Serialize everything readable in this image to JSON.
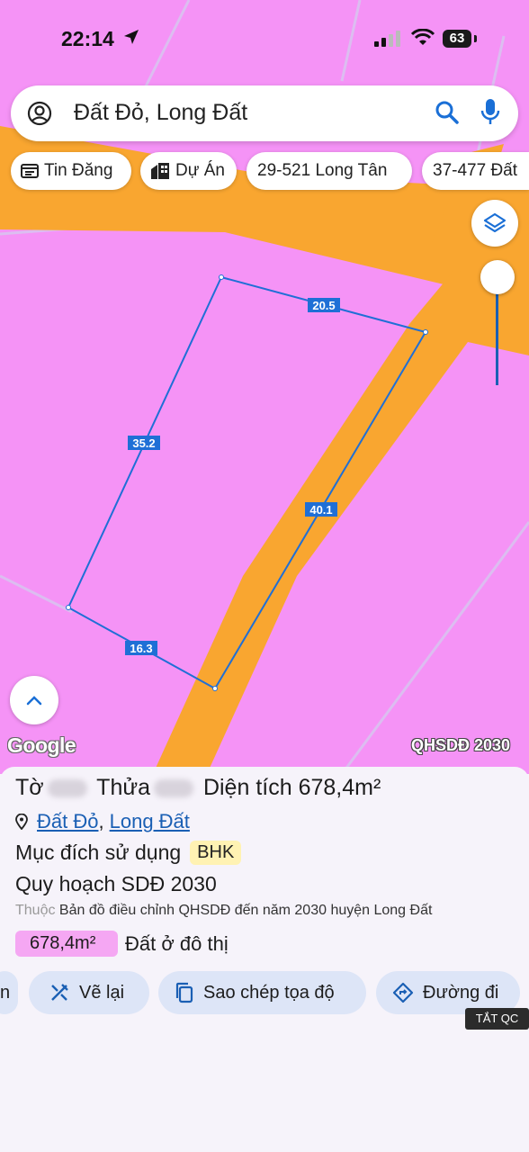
{
  "status": {
    "time": "22:14",
    "battery": "63"
  },
  "search": {
    "query": "Đất Đỏ, Long Đất"
  },
  "chips": [
    {
      "label": "Tin Đăng",
      "icon": "listing-icon"
    },
    {
      "label": "Dự Án",
      "icon": "buildings-icon"
    },
    {
      "label": "29-521 Long Tân"
    },
    {
      "label": "37-477 Đất"
    }
  ],
  "map": {
    "edge_labels": {
      "top": "20.5",
      "left": "35.2",
      "right": "40.1",
      "bottom": "16.3"
    },
    "google_logo": "Google",
    "layer_tag": "QHSDĐ 2030",
    "colors": {
      "land": "#f593f6",
      "road": "#f9a630",
      "boundary": "#1f6fd6"
    }
  },
  "parcel": {
    "sheet_label": "Tờ",
    "plot_label": "Thửa",
    "area_label": "Diện tích",
    "area_value": "678,4m²",
    "location_district": "Đất Đỏ",
    "location_sep": ",",
    "location_province": "Long Đất",
    "purpose_label": "Mục đích sử dụng",
    "purpose_code": "BHK",
    "plan_label": "Quy hoạch SDĐ 2030",
    "source_prefix": "Thuộc",
    "source_text": "Bản đồ điều chỉnh QHSDĐ đến năm 2030 huyện Long Đất",
    "zone_area": "678,4m²",
    "zone_label": "Đất ở đô thị"
  },
  "actions": {
    "redraw": "Vẽ lại",
    "copy_coords": "Sao chép tọa độ",
    "directions": "Đường đi",
    "partial_left": "n"
  },
  "ad_tag": "TẮT QC"
}
